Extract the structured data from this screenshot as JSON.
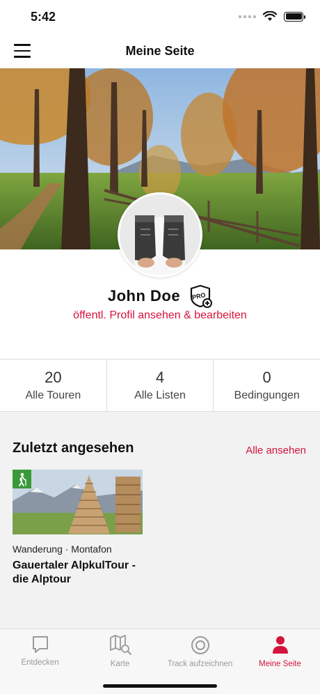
{
  "status": {
    "time": "5:42"
  },
  "nav": {
    "title": "Meine Seite"
  },
  "profile": {
    "name": "John Doe",
    "badge_text": "PRO",
    "link": "öffentl. Profil ansehen & bearbeiten"
  },
  "stats": [
    {
      "value": "20",
      "label": "Alle Touren"
    },
    {
      "value": "4",
      "label": "Alle Listen"
    },
    {
      "value": "0",
      "label": "Bedingungen"
    }
  ],
  "recent": {
    "title": "Zuletzt angesehen",
    "see_all": "Alle ansehen",
    "tours": [
      {
        "meta": "Wanderung · Montafon",
        "name": "Gauertaler AlpkulTour - die Alptour",
        "icon": "hiking-icon"
      }
    ]
  },
  "tabs": [
    {
      "label": "Entdecken",
      "icon": "chat-bubble-icon",
      "active": false
    },
    {
      "label": "Karte",
      "icon": "map-search-icon",
      "active": false
    },
    {
      "label": "Track aufzeichnen",
      "icon": "record-icon",
      "active": false
    },
    {
      "label": "Meine Seite",
      "icon": "person-icon",
      "active": true
    }
  ],
  "colors": {
    "accent": "#d4143c",
    "tab_inactive": "#9a9a9a",
    "hiking_green": "#3a9a3a"
  }
}
